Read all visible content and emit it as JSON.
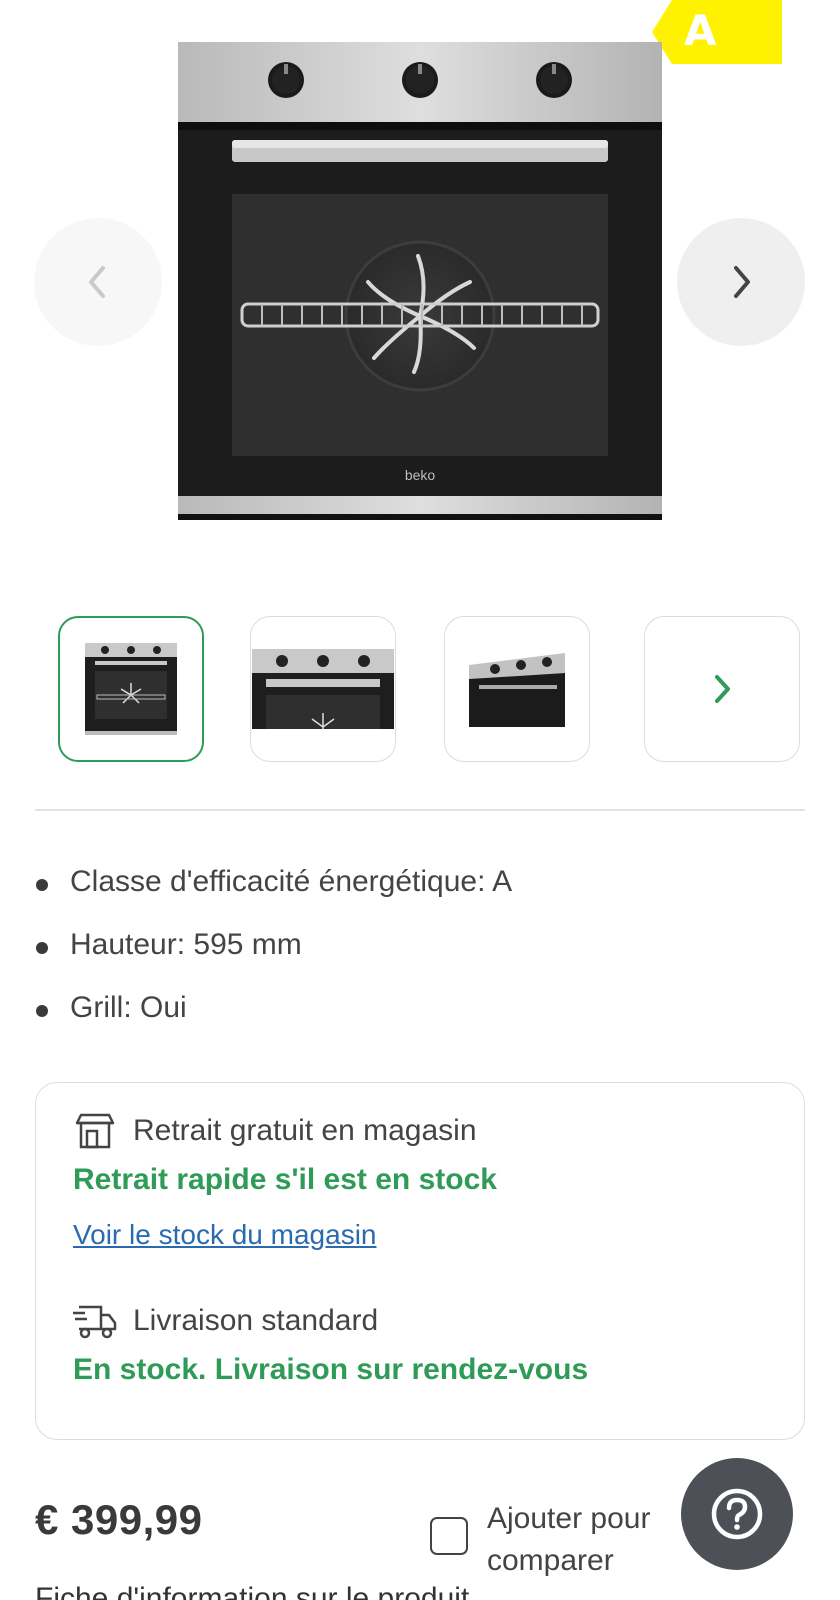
{
  "gallery": {
    "energy_class_badge": "A",
    "brand_logo_text": "beko",
    "prev_icon": "chevron-left-icon",
    "next_icon": "chevron-right-icon",
    "thumbnails_more_icon": "chevron-right-icon"
  },
  "specs": [
    {
      "label": "Classe d'efficacité énergétique: A"
    },
    {
      "label": "Hauteur: 595 mm"
    },
    {
      "label": "Grill: Oui"
    }
  ],
  "delivery": {
    "pickup": {
      "icon": "store-icon",
      "title": "Retrait gratuit en magasin",
      "status": "Retrait rapide s'il est en stock",
      "link": "Voir le stock du magasin"
    },
    "shipping": {
      "icon": "delivery-truck-icon",
      "title": "Livraison standard",
      "status": "En stock. Livraison sur rendez-vous"
    }
  },
  "purchase": {
    "price": "€ 399,99",
    "compare_label": "Ajouter pour comparer",
    "compare_checked": false,
    "help_icon": "help-question-icon",
    "cutoff_text": "Fiche d'information sur le produit"
  },
  "colors": {
    "accent_green": "#2e9b57",
    "link_blue": "#2a6bb0",
    "energy_yellow": "#fff200",
    "help_button": "#4d5157"
  }
}
